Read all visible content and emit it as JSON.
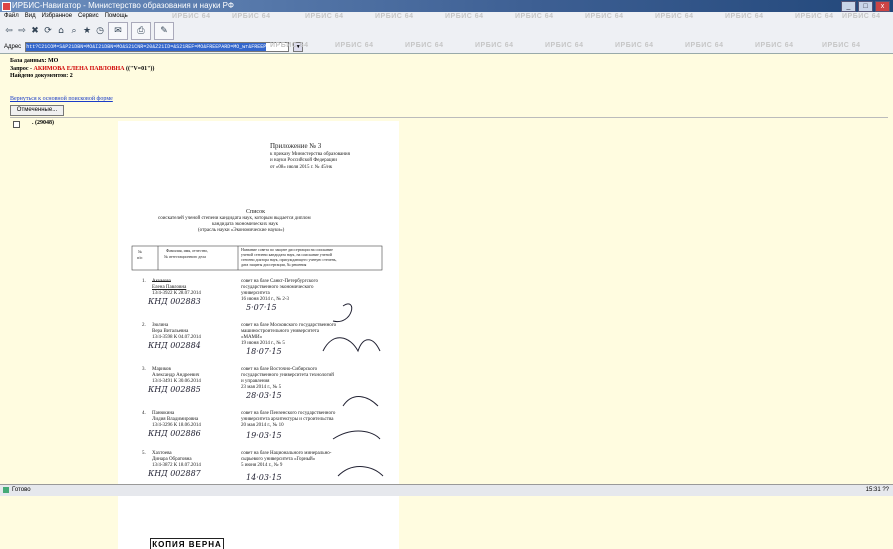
{
  "window": {
    "title": "ИРБИС-Навигатор - Министерство образования и науки РФ",
    "buttons": [
      "_",
      "□",
      "x"
    ]
  },
  "menu": [
    "Файл",
    "Вид",
    "Избранное",
    "Сервис",
    "Помощь"
  ],
  "address": {
    "label": "Адрес",
    "value": "htt?C21COM=S&P21DBN=MO&I21DBN=MO&S21CNR=20&Z21ID=&S21REF=MO&FREEPARD=MO_wr&FREEPARM"
  },
  "watermark": "ИРБИС 64",
  "results": {
    "db_label": "База данных: МО",
    "query_prefix": "Запрос - ",
    "query_surname": "АКИМОВА",
    "query_name": "ЕЛЕНА",
    "query_patronymic": "ПАВЛОВНА",
    "query_suffix": " ((\"V=01\"))",
    "found": "Найдено документов: 2",
    "back_link": "Вернуться к основной поисковой форме",
    "marked_button": "Отмеченные...",
    "doc_id": ". (29048)"
  },
  "scan": {
    "appendix": "Приложение № 3",
    "order1": "к приказу Министерства образования",
    "order2": "и науки Российской Федерации",
    "order3": "от «08» июля 2015 г. № 45/нк",
    "list_title": "Список",
    "list_sub1": "соискателей ученой степени кандидата наук, которым выдается диплом",
    "list_sub2": "кандидата экономических наук",
    "list_sub3": "(отрасль науки «Экономические науки»)",
    "col1a": "№",
    "col1b": "п/п",
    "col2a": "Фамилия, имя, отчество,",
    "col2b": "№ аттестационного дела",
    "col3a": "Название совета по защите диссертации на соискание",
    "col3b": "ученой степени кандидата наук, на соискание ученой",
    "col3c": "степени доктора наук, присуждающего ученую степень,",
    "col3d": "дата защиты диссертации, № решения",
    "entries": [
      {
        "n": "1.",
        "name1": "Акимова",
        "name2": "Елена Павловна",
        "case": "13/4-3922 К 28.07.2014",
        "diploma": "КНД 002883",
        "c1": "совет на базе Санкт-Петербургского",
        "c2": "государственного экономического",
        "c3": "университета",
        "c4": "16 июня 2014 г., № 2-3",
        "date": "5·07·15"
      },
      {
        "n": "2.",
        "name1": "Зюлина",
        "name2": "Вера Витальевна",
        "case": "13/4-3598 К 04.07.2014",
        "diploma": "КНД 002884",
        "c1": "совет на базе Московского государственного",
        "c2": "машиностроительного университета",
        "c3": "«МАМИ»",
        "c4": "19 июня 2014 г., № 5",
        "date": "18·07·15"
      },
      {
        "n": "3.",
        "name1": "Мариков",
        "name2": "Александр Андреевич",
        "case": "13/4-3491 К 30.06.2014",
        "diploma": "КНД 002885",
        "c1": "совет на базе Восточно-Сибирского",
        "c2": "государственного университета технологий",
        "c3": "и управления",
        "c4": "23 мая 2014 г., № 5",
        "date": "28·03·15"
      },
      {
        "n": "4.",
        "name1": "Панюкина",
        "name2": "Лидия Владимировна",
        "case": "13/4-3296 К 18.06.2014",
        "diploma": "КНД 002886",
        "c1": "совет на базе Пензенского государственного",
        "c2": "университета архитектуры и строительства",
        "c3": "20 мая 2014 г., № 10",
        "c4": "",
        "date": "19·03·15"
      },
      {
        "n": "5.",
        "name1": "Хахтоева",
        "name2": "Динара Обратовна",
        "case": "13/4-3872 К 18.07.2014",
        "diploma": "КНД 002887",
        "c1": "совет на базе Национального минерально-",
        "c2": "сырьевого университета «Горный»",
        "c3": "5 июня 2014 г., № 9",
        "c4": "",
        "date": "14·03·15"
      }
    ],
    "stamp": "КОПИЯ ВЕРНА"
  },
  "status": {
    "text": "Готово",
    "clock": "15:31 ??"
  }
}
